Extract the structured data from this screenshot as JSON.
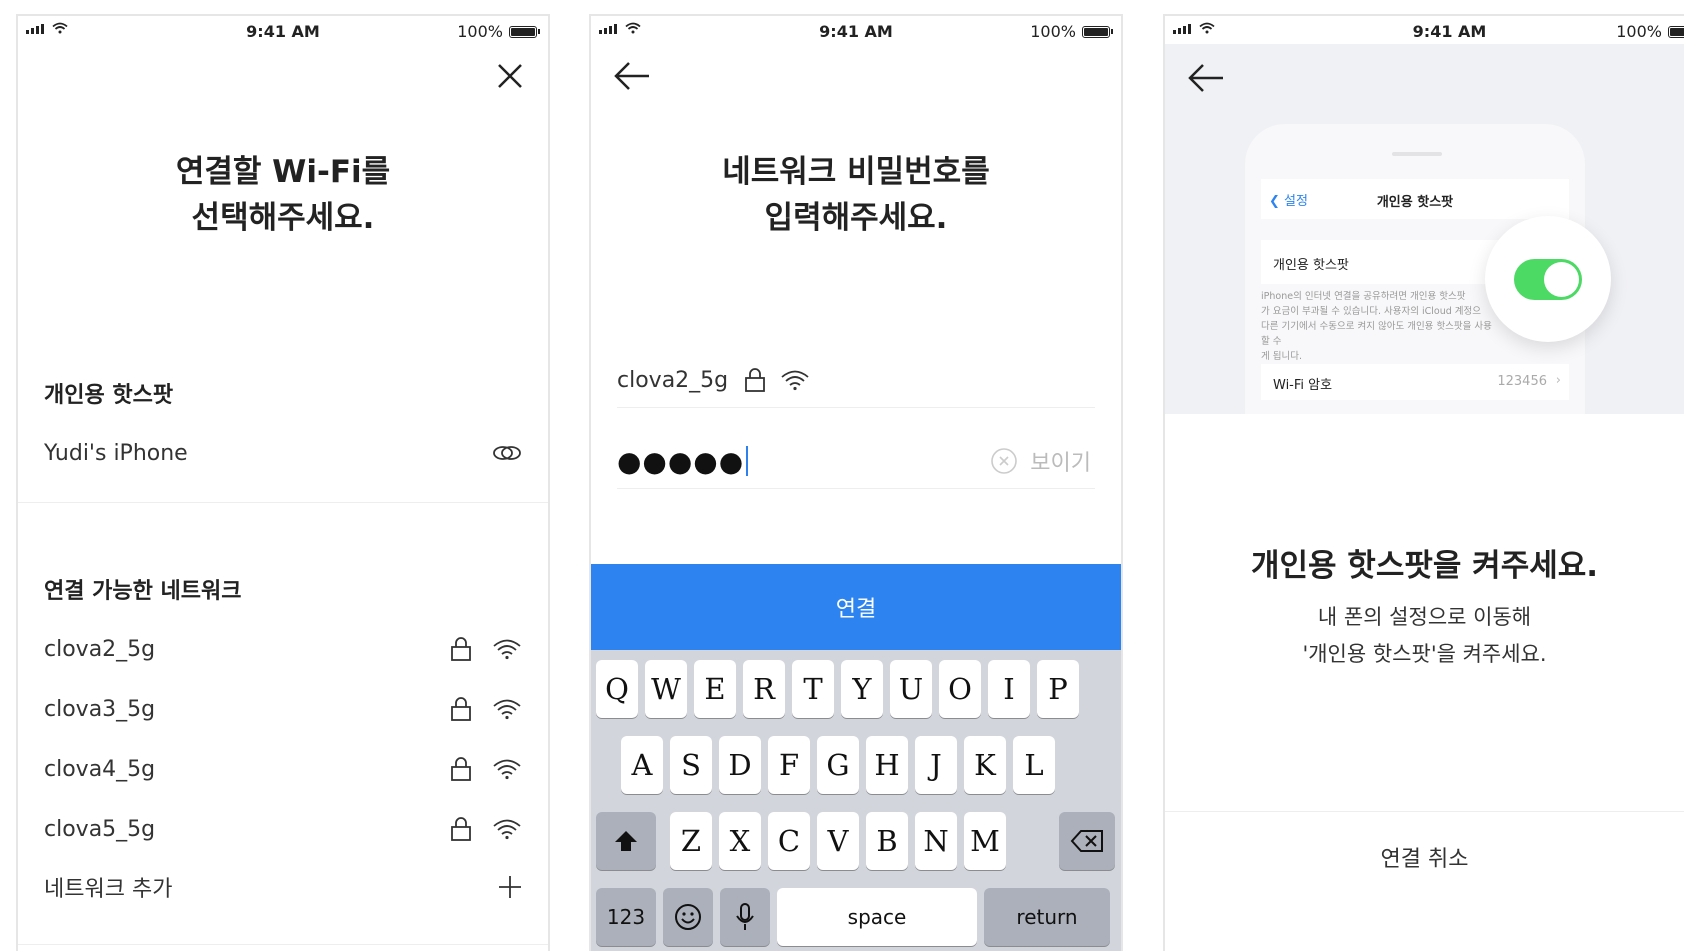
{
  "status_bar": {
    "time": "9:41 AM",
    "battery": "100%"
  },
  "screen1": {
    "headline": [
      "연결할 Wi-Fi를",
      "선택해주세요."
    ],
    "hotspot_section": "개인용 핫스팟",
    "hotspot_item": "Yudi's iPhone",
    "networks_section": "연결 가능한 네트워크",
    "networks": [
      "clova2_5g",
      "clova3_5g",
      "clova4_5g",
      "clova5_5g"
    ],
    "add_network": "네트워크 추가"
  },
  "screen2": {
    "headline": [
      "네트워크 비밀번호를",
      "입력해주세요."
    ],
    "ssid": "clova2_5g",
    "password_mask": "●●●●●",
    "show_password": "보이기",
    "connect_button": "연결",
    "keyboard": {
      "row1": [
        "Q",
        "W",
        "E",
        "R",
        "T",
        "Y",
        "U",
        "O",
        "I",
        "P"
      ],
      "row2": [
        "A",
        "S",
        "D",
        "F",
        "G",
        "H",
        "J",
        "K",
        "L"
      ],
      "row3": [
        "Z",
        "X",
        "C",
        "V",
        "B",
        "N",
        "M"
      ],
      "numbers": "123",
      "space": "space",
      "return": "return"
    }
  },
  "screen3": {
    "mock": {
      "nav_back": "설정",
      "nav_title": "개인용 핫스팟",
      "cell_label": "개인용 핫스팟",
      "description": [
        "iPhone의 인터넷 연결을 공유하려면 개인용 핫스팟",
        "가 요금이 부과될 수 있습니다. 사용자의 iCloud 계정으",
        "다른 기기에서 수동으로 켜지 않아도 개인용 핫스팟을 사용할 수",
        "게 됩니다."
      ],
      "wifi_label": "Wi-Fi 암호",
      "wifi_value": "123456",
      "toggle_on": true
    },
    "title": "개인용 핫스팟을 켜주세요.",
    "body": [
      "내 폰의 설정으로 이동해",
      "'개인용 핫스팟'을 켜주세요."
    ],
    "cancel": "연결 취소"
  },
  "colors": {
    "accent": "#2d84f0",
    "toggle_on": "#4cd964"
  }
}
